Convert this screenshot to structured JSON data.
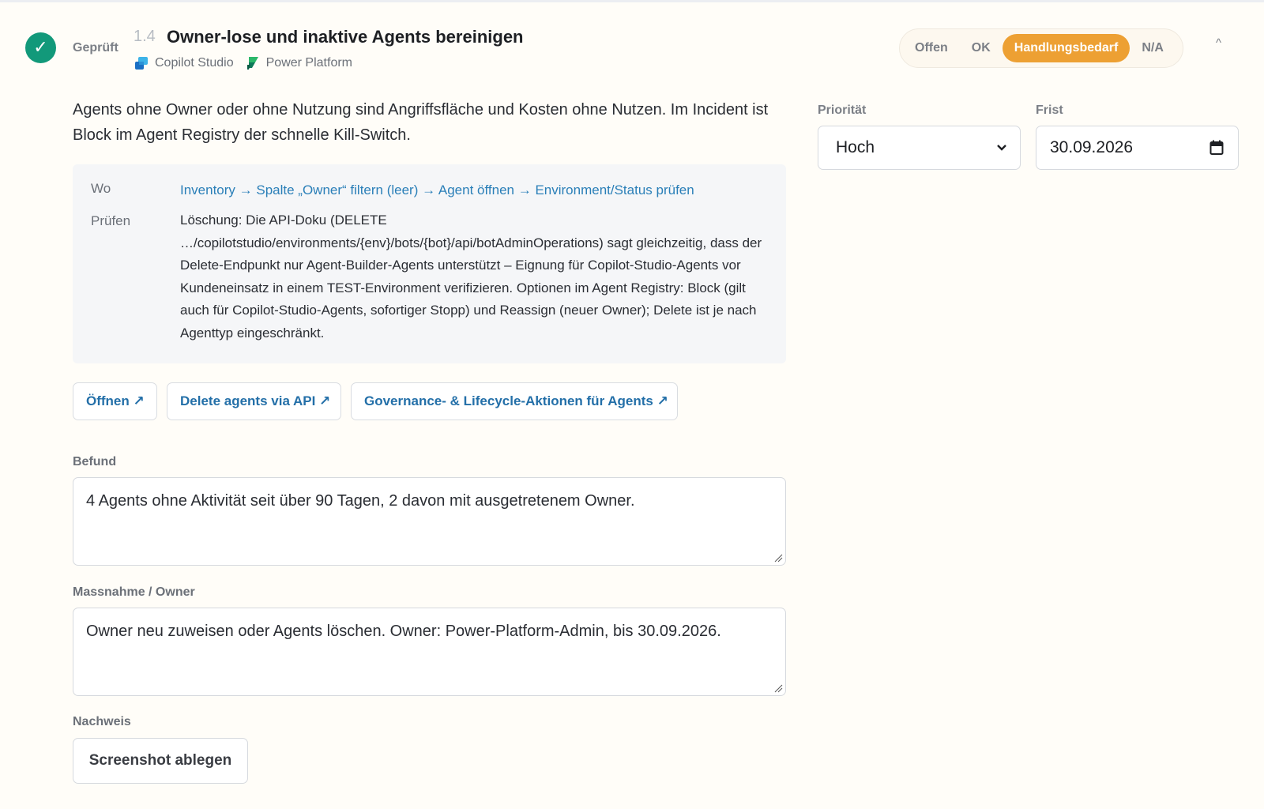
{
  "header": {
    "status": "Geprüft",
    "number": "1.4",
    "title": "Owner-lose und inaktive Agents bereinigen",
    "tags": [
      {
        "label": "Copilot Studio",
        "icon": "copilot-studio-icon"
      },
      {
        "label": "Power Platform",
        "icon": "power-platform-icon"
      }
    ],
    "status_options": [
      "Offen",
      "OK",
      "Handlungsbedarf",
      "N/A"
    ],
    "selected_status": "Handlungsbedarf",
    "collapse": "^"
  },
  "description": "Agents ohne Owner oder ohne Nutzung sind Angriffsfläche und Kosten ohne Nutzen. Im Incident ist Block im Agent Registry der schnelle Kill-Switch.",
  "info": {
    "wo_label": "Wo",
    "wo_value": "Inventory → Spalte „Owner“ filtern (leer) → Agent öffnen → Environment/Status prüfen",
    "pruefen_label": "Prüfen",
    "pruefen_value": "Löschung: Die API-Doku (DELETE …/copilotstudio/environments/{env}/bots/{bot}/api/botAdminOperations) sagt gleichzeitig, dass der Delete-Endpunkt nur Agent-Builder-Agents unterstützt – Eignung für Copilot-Studio-Agents vor Kundeneinsatz in einem TEST-Environment verifizieren. Optionen im Agent Registry: Block (gilt auch für Copilot-Studio-Agents, sofortiger Stopp) und Reassign (neuer Owner); Delete ist je nach Agenttyp eingeschränkt."
  },
  "links": {
    "open": "Öffnen ↗",
    "delete_api": "Delete agents via API ↗",
    "governance": "Governance- & Lifecycle-Aktionen für Agents ↗"
  },
  "fields": {
    "befund_label": "Befund",
    "befund_value": "4 Agents ohne Aktivität seit über 90 Tagen, 2 davon mit ausgetretenem Owner.",
    "massnahme_label": "Massnahme / Owner",
    "massnahme_value": "Owner neu zuweisen oder Agents löschen. Owner: Power-Platform-Admin, bis 30.09.2026.",
    "nachweis_label": "Nachweis",
    "upload_label": "Screenshot ablegen"
  },
  "side": {
    "prioritaet_label": "Priorität",
    "prioritaet_value": "Hoch",
    "frist_label": "Frist",
    "frist_value": "30.09.2026"
  },
  "colors": {
    "accent": "#eda033",
    "check": "#12997a",
    "link": "#2a7fb8"
  }
}
